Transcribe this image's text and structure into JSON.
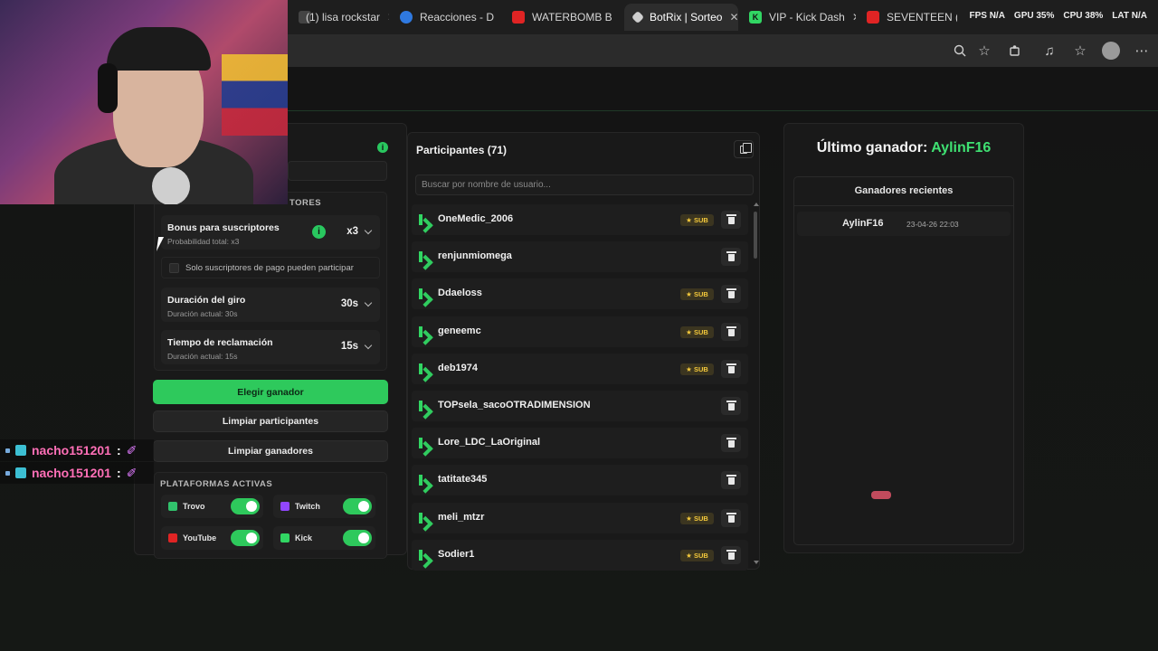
{
  "browser": {
    "tabs": [
      {
        "label": "(1) lisa rockstar",
        "icon": "tab-favicon",
        "color": "#444444"
      },
      {
        "label": "Reacciones - D",
        "icon": "tab-favicon",
        "color": "#2f79e0"
      },
      {
        "label": "WATERBOMB B",
        "icon": "youtube-icon",
        "color": "#e02424"
      },
      {
        "label": "BotRix | Sorteo",
        "icon": "botrix-icon",
        "color": "#cfcfcf"
      },
      {
        "label": "VIP - Kick Dash",
        "icon": "kick-icon",
        "color": "#31d663"
      },
      {
        "label": "SEVENTEEN (",
        "icon": "youtube-icon",
        "color": "#e02424"
      }
    ],
    "close_glyph": "✕",
    "perf": {
      "fps": "FPS N/A",
      "gpu": "GPU 35%",
      "cpu": "CPU 38%",
      "lat": "LAT N/A"
    }
  },
  "chat": [
    {
      "user": "nacho151201",
      "colon": ":",
      "emote": "✐"
    },
    {
      "user": "nacho151201",
      "colon": ":",
      "emote": "✐"
    }
  ],
  "settings": {
    "group_title": "TORES",
    "bonus": {
      "title": "Bonus para suscriptores",
      "sub": "Probabilidad total: x3",
      "value": "x3",
      "info": "i"
    },
    "paid_only": "Solo suscriptores de pago pueden participar",
    "duration": {
      "title": "Duración del giro",
      "sub": "Duración actual: 30s",
      "value": "30s"
    },
    "claim": {
      "title": "Tiempo de reclamación",
      "sub": "Duración actual: 15s",
      "value": "15s"
    },
    "pick_winner": "Elegir ganador",
    "clear_participants": "Limpiar participantes",
    "clear_winners": "Limpiar ganadores",
    "platforms_title": "PLATAFORMAS ACTIVAS",
    "platforms": [
      {
        "name": "Trovo",
        "icon": "trovo-icon",
        "color": "#31c26c",
        "enabled": true
      },
      {
        "name": "Twitch",
        "icon": "twitch-icon",
        "color": "#9146ff",
        "enabled": true
      },
      {
        "name": "YouTube",
        "icon": "youtube-icon",
        "color": "#e02424",
        "enabled": true
      },
      {
        "name": "Kick",
        "icon": "kick-icon",
        "color": "#31d663",
        "enabled": true
      }
    ],
    "info_dot": "i"
  },
  "participants": {
    "title": "Participantes (71)",
    "search_placeholder": "Buscar por nombre de usuario...",
    "sub_label": "★ SUB",
    "rows": [
      {
        "name": "OneMedic_2006",
        "sub": true
      },
      {
        "name": "renjunmiomega",
        "sub": false
      },
      {
        "name": "Ddaeloss",
        "sub": true
      },
      {
        "name": "geneemc",
        "sub": true
      },
      {
        "name": "deb1974",
        "sub": true
      },
      {
        "name": "TOPsela_sacoOTRADIMENSION",
        "sub": false
      },
      {
        "name": "Lore_LDC_LaOriginal",
        "sub": false
      },
      {
        "name": "tatitate345",
        "sub": false
      },
      {
        "name": "meli_mtzr",
        "sub": true
      },
      {
        "name": "Sodier1",
        "sub": true
      }
    ]
  },
  "winner": {
    "label": "Último ganador: ",
    "name": "AylinF16",
    "recent_title": "Ganadores recientes",
    "recent": [
      {
        "name": "AylinF16",
        "date": "23-04-26 22:03"
      }
    ]
  },
  "colors": {
    "accent": "#2ec95c",
    "winner": "#3fe072",
    "sub_badge": "#f4c93b"
  }
}
